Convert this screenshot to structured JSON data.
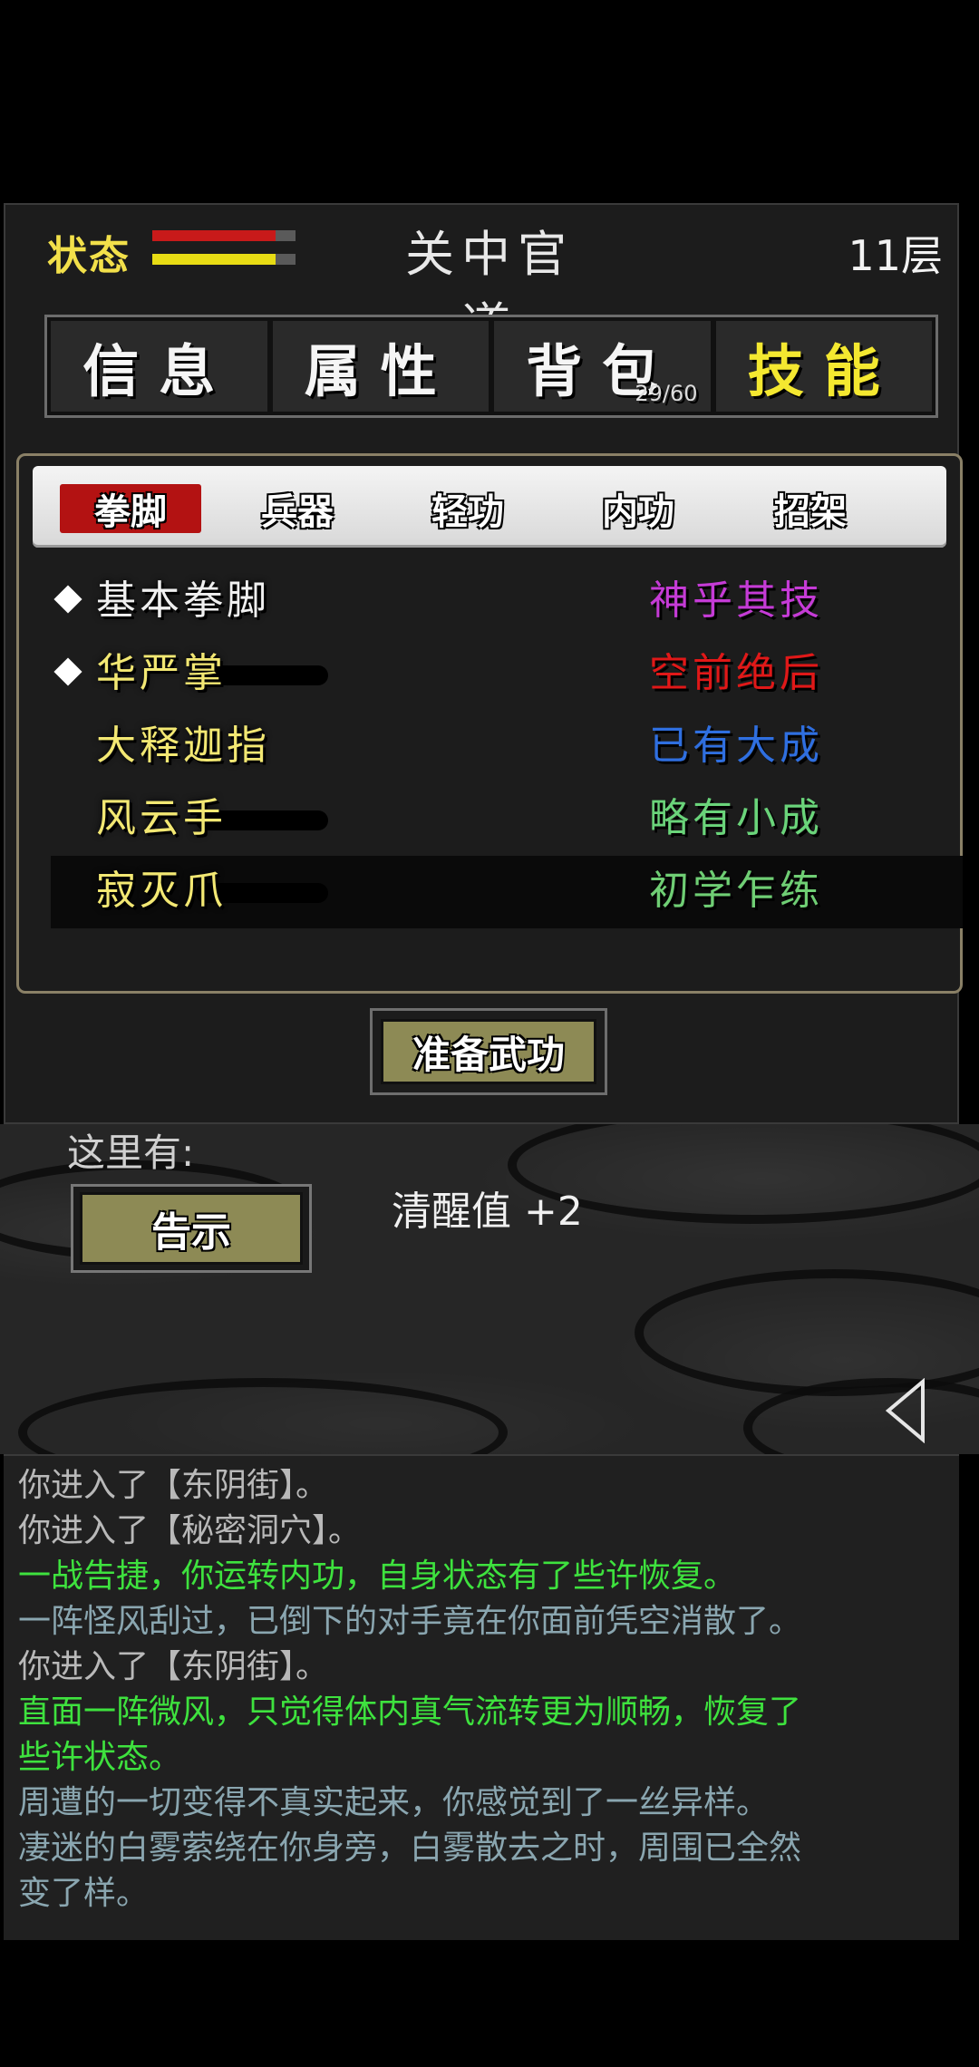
{
  "header": {
    "status_label": "状态",
    "location": "关中官道",
    "floor": "11层",
    "health_level": 0.86,
    "stamina_level": 0.86
  },
  "main_tabs": [
    {
      "label": "信息",
      "active": false
    },
    {
      "label": "属性",
      "active": false
    },
    {
      "label": "背包",
      "active": false,
      "counter": "29/60"
    },
    {
      "label": "技能",
      "active": true
    }
  ],
  "sub_tabs": [
    {
      "label": "拳脚",
      "active": true
    },
    {
      "label": "兵器",
      "active": false
    },
    {
      "label": "轻功",
      "active": false
    },
    {
      "label": "内功",
      "active": false
    },
    {
      "label": "招架",
      "active": false
    }
  ],
  "skills": [
    {
      "name": "基本拳脚",
      "level": "神乎其技",
      "level_color": "#c53bd6",
      "equipped": true,
      "name_color": "white"
    },
    {
      "name": "华严掌",
      "level": "空前绝后",
      "level_color": "#e01818",
      "equipped": true,
      "name_color": "yellow"
    },
    {
      "name": "大释迦指",
      "level": "已有大成",
      "level_color": "#2f6fe0",
      "equipped": false,
      "name_color": "yellow"
    },
    {
      "name": "风云手",
      "level": "略有小成",
      "level_color": "#6ad47a",
      "equipped": false,
      "name_color": "yellow"
    },
    {
      "name": "寂灭爪",
      "level": "初学乍练",
      "level_color": "#6fce74",
      "equipped": false,
      "name_color": "yellow",
      "selected": true
    }
  ],
  "ready_button": "准备武功",
  "scene": {
    "here_label": "这里有:",
    "notice_button": "告示",
    "sober_text": "清醒值 +2"
  },
  "log": [
    {
      "text": "你进入了【东阴街】。",
      "color": "#b9b9b9"
    },
    {
      "text": "你进入了【秘密洞穴】。",
      "color": "#b9b9b9"
    },
    {
      "text": "一战告捷，你运转内功，自身状态有了些许恢复。",
      "color": "#3ee23e"
    },
    {
      "text": "一阵怪风刮过，已倒下的对手竟在你面前凭空消散了。",
      "color": "#8aa6b0"
    },
    {
      "text": "你进入了【东阴街】。",
      "color": "#b9b9b9"
    },
    {
      "text": "直面一阵微风，只觉得体内真气流转更为顺畅，恢复了",
      "color": "#3ee23e"
    },
    {
      "text": "些许状态。",
      "color": "#3ee23e"
    },
    {
      "text": "周遭的一切变得不真实起来，你感觉到了一丝异样。",
      "color": "#8aa6b0"
    },
    {
      "text": "凄迷的白雾萦绕在你身旁，白雾散去之时，周围已全然",
      "color": "#8aa6b0"
    },
    {
      "text": "变了样。",
      "color": "#8aa6b0"
    }
  ],
  "colors": {
    "health": "#c81a1a",
    "stamina": "#e8dc14",
    "accent_yellow": "#f4e830",
    "button_olive": "#8d8a55"
  }
}
